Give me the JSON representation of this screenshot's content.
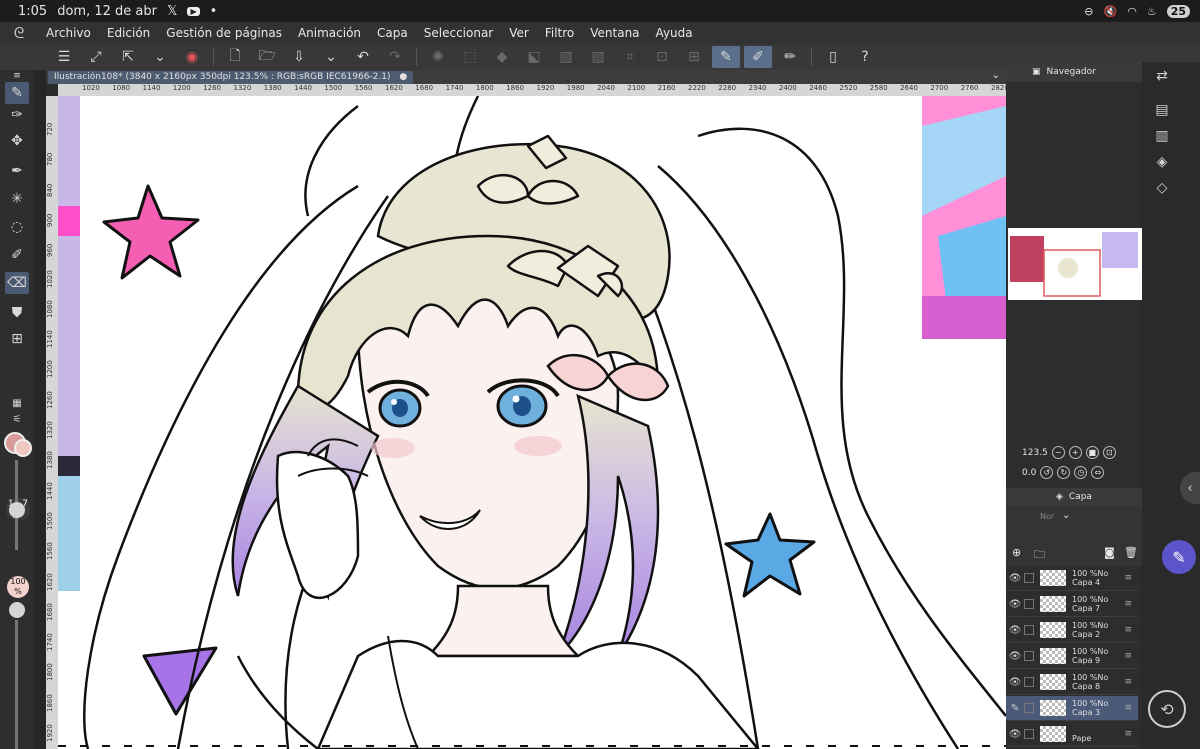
{
  "status_bar": {
    "time": "1:05",
    "date": "dom, 12 de abr",
    "battery": "25"
  },
  "menu": {
    "items": [
      "Archivo",
      "Edición",
      "Gestión de páginas",
      "Animación",
      "Capa",
      "Seleccionar",
      "Ver",
      "Filtro",
      "Ventana",
      "Ayuda"
    ]
  },
  "document": {
    "tab_label": "Ilustración108* (3840 x 2160px 350dpi 123.5% : RGB:sRGB IEC61966-2.1)"
  },
  "rulers": {
    "horizontal": [
      "1020",
      "1080",
      "1140",
      "1200",
      "1260",
      "1320",
      "1380",
      "1440",
      "1500",
      "1560",
      "1620",
      "1680",
      "1740",
      "1800",
      "1860",
      "1920",
      "1980",
      "2040",
      "2100",
      "2160",
      "2220",
      "2280",
      "2340",
      "2400",
      "2460",
      "2520",
      "2580",
      "2640",
      "2700",
      "2760",
      "2820"
    ],
    "vertical": [
      "720",
      "780",
      "840",
      "900",
      "960",
      "1020",
      "1080",
      "1140",
      "1200",
      "1260",
      "1320",
      "1380",
      "1440",
      "1500",
      "1560",
      "1620",
      "1680",
      "1740",
      "1800",
      "1860",
      "1920"
    ]
  },
  "tool_panel": {
    "brush_size": "14.7",
    "brush_unit": "px",
    "opacity": "100",
    "opacity_unit": "%"
  },
  "navigator": {
    "title": "Navegador",
    "zoom": "123.5",
    "rotation": "0.0"
  },
  "layers": {
    "title": "Capa",
    "blend_placeholder": "Nor",
    "items": [
      {
        "opacity": "100 %No",
        "name": "Capa 4",
        "selected": false
      },
      {
        "opacity": "100 %No",
        "name": "Capa 7",
        "selected": false
      },
      {
        "opacity": "100 %No",
        "name": "Capa 2",
        "selected": false
      },
      {
        "opacity": "100 %No",
        "name": "Capa 9",
        "selected": false
      },
      {
        "opacity": "100 %No",
        "name": "Capa 8",
        "selected": false
      },
      {
        "opacity": "100 %No",
        "name": "Capa 3",
        "selected": true
      },
      {
        "opacity": "",
        "name": "Pape",
        "selected": false
      }
    ]
  },
  "colors": {
    "accent": "#5c55c9",
    "main_color": "#d99a9a",
    "sub_color": "#f0c7c0",
    "selected_layer": "#4a5a78"
  }
}
